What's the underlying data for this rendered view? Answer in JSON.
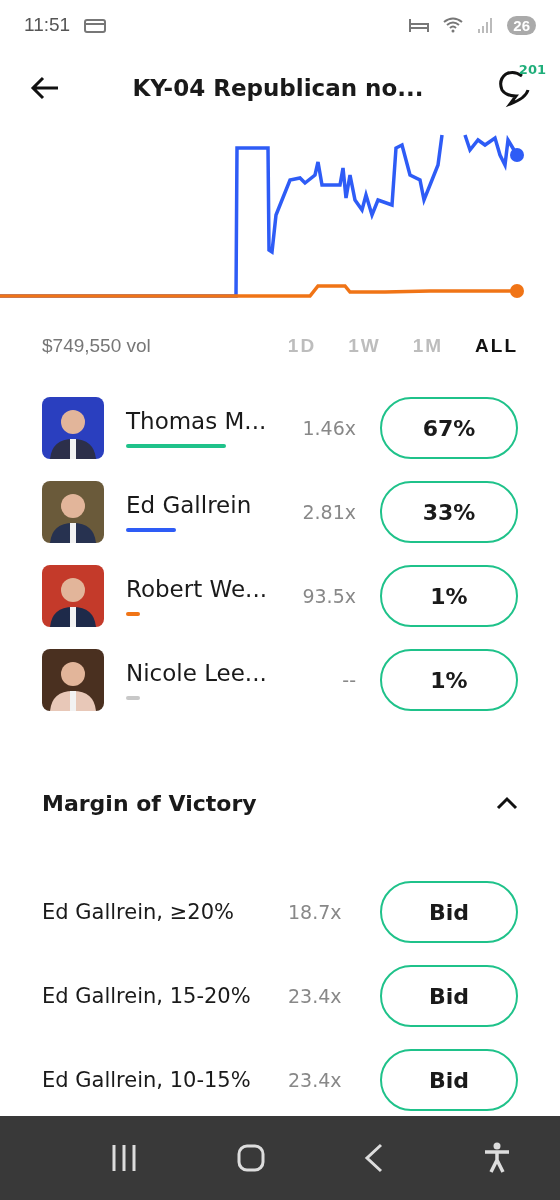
{
  "status_bar": {
    "time": "11:51",
    "battery": "26"
  },
  "header": {
    "title": "KY-04 Republican no...",
    "comment_count": "201"
  },
  "volume": "$749,550 vol",
  "timeframes": [
    {
      "label": "1D",
      "selected": false
    },
    {
      "label": "1W",
      "selected": false
    },
    {
      "label": "1M",
      "selected": false
    },
    {
      "label": "ALL",
      "selected": true
    }
  ],
  "candidates": [
    {
      "name": "Thomas M...",
      "multiplier": "1.46x",
      "price": "67%",
      "color": "#1fc28a"
    },
    {
      "name": "Ed Gallrein",
      "multiplier": "2.81x",
      "price": "33%",
      "color": "#2e5cf6"
    },
    {
      "name": "Robert We...",
      "multiplier": "93.5x",
      "price": "1%",
      "color": "#f07416"
    },
    {
      "name": "Nicole Lee...",
      "multiplier": "--",
      "price": "1%",
      "color": "#c8c8c8"
    }
  ],
  "section": {
    "title": "Margin of Victory",
    "expanded": true
  },
  "margin_rows": [
    {
      "label": "Ed Gallrein, ≥20%",
      "multiplier": "18.7x",
      "action": "Bid"
    },
    {
      "label": "Ed Gallrein, 15-20%",
      "multiplier": "23.4x",
      "action": "Bid"
    },
    {
      "label": "Ed Gallrein, 10-15%",
      "multiplier": "23.4x",
      "action": "Bid"
    }
  ]
}
